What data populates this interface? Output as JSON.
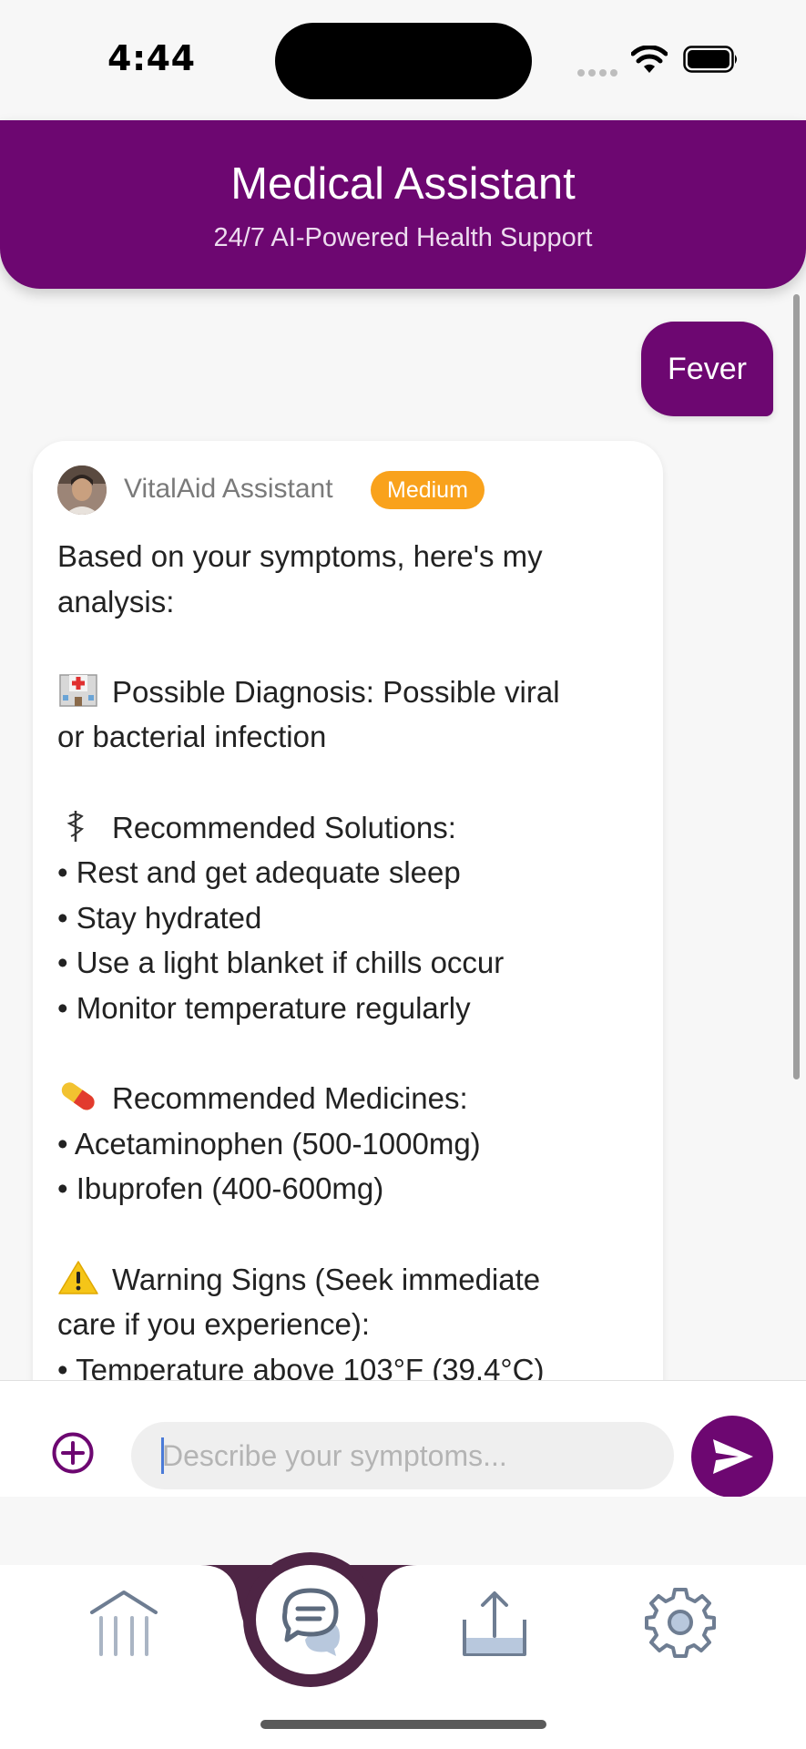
{
  "status_bar": {
    "time": "4:44"
  },
  "header": {
    "title": "Medical Assistant",
    "subtitle": "24/7 AI-Powered Health Support"
  },
  "chat": {
    "user_message": "Fever",
    "assistant": {
      "name": "VitalAid Assistant",
      "severity_badge": "Medium",
      "intro_line1": "Based on your symptoms, here's my",
      "intro_line2": "analysis:",
      "diagnosis_line1": "Possible Diagnosis: Possible viral",
      "diagnosis_line2": "or bacterial infection",
      "solutions_heading": "Recommended Solutions:",
      "solutions": [
        "• Rest and get adequate sleep",
        "• Stay hydrated",
        "• Use a light blanket if chills occur",
        "• Monitor temperature regularly"
      ],
      "medicines_heading": "Recommended Medicines:",
      "medicines": [
        "• Acetaminophen (500-1000mg)",
        "• Ibuprofen (400-600mg)"
      ],
      "warning_line1": "Warning Signs (Seek immediate",
      "warning_line2": "care if you experience):",
      "warnings": [
        "• Temperature above 103°F (39.4°C)"
      ]
    }
  },
  "input": {
    "placeholder": "Describe your symptoms..."
  },
  "nav": {
    "items": [
      "home-icon",
      "chat-icon",
      "share-icon",
      "settings-icon"
    ],
    "active": "chat-icon"
  },
  "colors": {
    "brand_purple": "#6d0771",
    "badge_orange": "#f9a21c",
    "nav_active_ring": "#4e2545"
  }
}
